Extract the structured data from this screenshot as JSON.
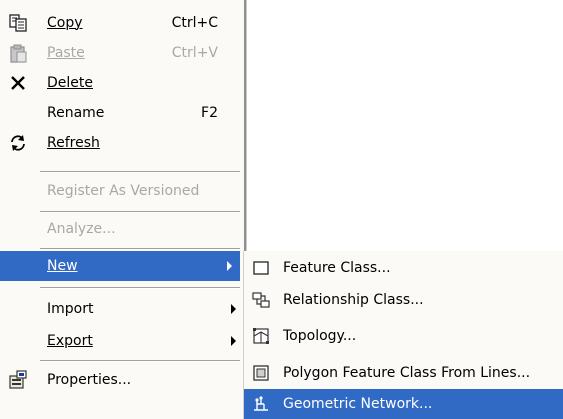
{
  "context_menu": {
    "copy": {
      "label": "Copy",
      "shortcut": "Ctrl+C",
      "icon": "copy-icon"
    },
    "paste": {
      "label": "Paste",
      "shortcut": "Ctrl+V",
      "icon": "paste-icon",
      "state": "disabled"
    },
    "delete": {
      "label": "Delete",
      "icon": "delete-x-icon"
    },
    "rename": {
      "label": "Rename",
      "shortcut": "F2"
    },
    "refresh": {
      "label": "Refresh",
      "icon": "refresh-icon"
    },
    "register_as_versioned": {
      "label": "Register As Versioned",
      "state": "disabled"
    },
    "analyze": {
      "label": "Analyze...",
      "state": "disabled"
    },
    "new": {
      "label": "New",
      "state": "highlighted"
    },
    "import": {
      "label": "Import"
    },
    "export": {
      "label": "Export"
    },
    "properties": {
      "label": "Properties...",
      "icon": "properties-icon"
    }
  },
  "new_submenu": {
    "feature_class": {
      "label": "Feature Class...",
      "icon": "feature-class-icon"
    },
    "relationship_class": {
      "label": "Relationship Class...",
      "icon": "relationship-class-icon"
    },
    "topology": {
      "label": "Topology...",
      "icon": "topology-icon"
    },
    "polygon_feature_class_from_lines": {
      "label": "Polygon Feature Class From Lines...",
      "icon": "polygon-from-lines-icon"
    },
    "geometric_network": {
      "label": "Geometric Network...",
      "icon": "geometric-network-icon",
      "state": "highlighted"
    }
  },
  "colors": {
    "menu_background": "#fbfaf7",
    "highlight": "#316ac5",
    "disabled_text": "#a8a8a8"
  }
}
